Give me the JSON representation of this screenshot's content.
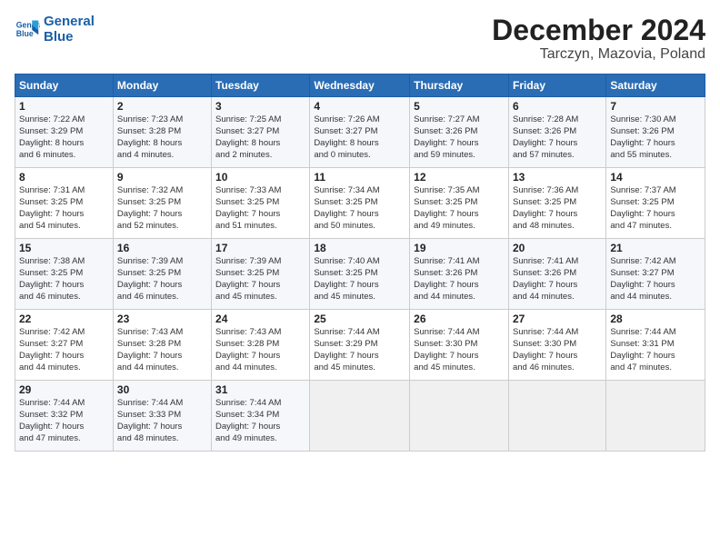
{
  "logo": {
    "line1": "General",
    "line2": "Blue"
  },
  "title": "December 2024",
  "subtitle": "Tarczyn, Mazovia, Poland",
  "days_of_week": [
    "Sunday",
    "Monday",
    "Tuesday",
    "Wednesday",
    "Thursday",
    "Friday",
    "Saturday"
  ],
  "weeks": [
    [
      {
        "day": 1,
        "info": "Sunrise: 7:22 AM\nSunset: 3:29 PM\nDaylight: 8 hours\nand 6 minutes."
      },
      {
        "day": 2,
        "info": "Sunrise: 7:23 AM\nSunset: 3:28 PM\nDaylight: 8 hours\nand 4 minutes."
      },
      {
        "day": 3,
        "info": "Sunrise: 7:25 AM\nSunset: 3:27 PM\nDaylight: 8 hours\nand 2 minutes."
      },
      {
        "day": 4,
        "info": "Sunrise: 7:26 AM\nSunset: 3:27 PM\nDaylight: 8 hours\nand 0 minutes."
      },
      {
        "day": 5,
        "info": "Sunrise: 7:27 AM\nSunset: 3:26 PM\nDaylight: 7 hours\nand 59 minutes."
      },
      {
        "day": 6,
        "info": "Sunrise: 7:28 AM\nSunset: 3:26 PM\nDaylight: 7 hours\nand 57 minutes."
      },
      {
        "day": 7,
        "info": "Sunrise: 7:30 AM\nSunset: 3:26 PM\nDaylight: 7 hours\nand 55 minutes."
      }
    ],
    [
      {
        "day": 8,
        "info": "Sunrise: 7:31 AM\nSunset: 3:25 PM\nDaylight: 7 hours\nand 54 minutes."
      },
      {
        "day": 9,
        "info": "Sunrise: 7:32 AM\nSunset: 3:25 PM\nDaylight: 7 hours\nand 52 minutes."
      },
      {
        "day": 10,
        "info": "Sunrise: 7:33 AM\nSunset: 3:25 PM\nDaylight: 7 hours\nand 51 minutes."
      },
      {
        "day": 11,
        "info": "Sunrise: 7:34 AM\nSunset: 3:25 PM\nDaylight: 7 hours\nand 50 minutes."
      },
      {
        "day": 12,
        "info": "Sunrise: 7:35 AM\nSunset: 3:25 PM\nDaylight: 7 hours\nand 49 minutes."
      },
      {
        "day": 13,
        "info": "Sunrise: 7:36 AM\nSunset: 3:25 PM\nDaylight: 7 hours\nand 48 minutes."
      },
      {
        "day": 14,
        "info": "Sunrise: 7:37 AM\nSunset: 3:25 PM\nDaylight: 7 hours\nand 47 minutes."
      }
    ],
    [
      {
        "day": 15,
        "info": "Sunrise: 7:38 AM\nSunset: 3:25 PM\nDaylight: 7 hours\nand 46 minutes."
      },
      {
        "day": 16,
        "info": "Sunrise: 7:39 AM\nSunset: 3:25 PM\nDaylight: 7 hours\nand 46 minutes."
      },
      {
        "day": 17,
        "info": "Sunrise: 7:39 AM\nSunset: 3:25 PM\nDaylight: 7 hours\nand 45 minutes."
      },
      {
        "day": 18,
        "info": "Sunrise: 7:40 AM\nSunset: 3:25 PM\nDaylight: 7 hours\nand 45 minutes."
      },
      {
        "day": 19,
        "info": "Sunrise: 7:41 AM\nSunset: 3:26 PM\nDaylight: 7 hours\nand 44 minutes."
      },
      {
        "day": 20,
        "info": "Sunrise: 7:41 AM\nSunset: 3:26 PM\nDaylight: 7 hours\nand 44 minutes."
      },
      {
        "day": 21,
        "info": "Sunrise: 7:42 AM\nSunset: 3:27 PM\nDaylight: 7 hours\nand 44 minutes."
      }
    ],
    [
      {
        "day": 22,
        "info": "Sunrise: 7:42 AM\nSunset: 3:27 PM\nDaylight: 7 hours\nand 44 minutes."
      },
      {
        "day": 23,
        "info": "Sunrise: 7:43 AM\nSunset: 3:28 PM\nDaylight: 7 hours\nand 44 minutes."
      },
      {
        "day": 24,
        "info": "Sunrise: 7:43 AM\nSunset: 3:28 PM\nDaylight: 7 hours\nand 44 minutes."
      },
      {
        "day": 25,
        "info": "Sunrise: 7:44 AM\nSunset: 3:29 PM\nDaylight: 7 hours\nand 45 minutes."
      },
      {
        "day": 26,
        "info": "Sunrise: 7:44 AM\nSunset: 3:30 PM\nDaylight: 7 hours\nand 45 minutes."
      },
      {
        "day": 27,
        "info": "Sunrise: 7:44 AM\nSunset: 3:30 PM\nDaylight: 7 hours\nand 46 minutes."
      },
      {
        "day": 28,
        "info": "Sunrise: 7:44 AM\nSunset: 3:31 PM\nDaylight: 7 hours\nand 47 minutes."
      }
    ],
    [
      {
        "day": 29,
        "info": "Sunrise: 7:44 AM\nSunset: 3:32 PM\nDaylight: 7 hours\nand 47 minutes."
      },
      {
        "day": 30,
        "info": "Sunrise: 7:44 AM\nSunset: 3:33 PM\nDaylight: 7 hours\nand 48 minutes."
      },
      {
        "day": 31,
        "info": "Sunrise: 7:44 AM\nSunset: 3:34 PM\nDaylight: 7 hours\nand 49 minutes."
      },
      null,
      null,
      null,
      null
    ]
  ]
}
